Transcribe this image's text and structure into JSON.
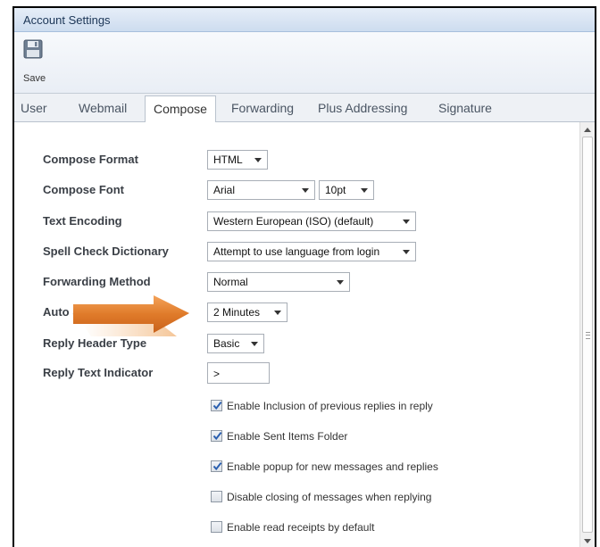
{
  "window": {
    "title": "Account Settings"
  },
  "toolbar": {
    "save_label": "Save",
    "save_icon": "floppy-disk-icon"
  },
  "tabs": [
    {
      "label": "User",
      "active": false
    },
    {
      "label": "Webmail",
      "active": false
    },
    {
      "label": "Compose",
      "active": true
    },
    {
      "label": "Forwarding",
      "active": false
    },
    {
      "label": "Plus Addressing",
      "active": false
    },
    {
      "label": "Signature",
      "active": false
    }
  ],
  "settings": {
    "compose_format": {
      "label": "Compose Format",
      "value": "HTML"
    },
    "compose_font": {
      "label": "Compose Font",
      "font": "Arial",
      "size": "10pt"
    },
    "text_encoding": {
      "label": "Text Encoding",
      "value": "Western European (ISO) (default)"
    },
    "spell_check": {
      "label": "Spell Check Dictionary",
      "value": "Attempt to use language from login"
    },
    "forwarding_method": {
      "label": "Forwarding Method",
      "value": "Normal"
    },
    "auto_save": {
      "label": "Auto Save Frequency",
      "value": "2 Minutes"
    },
    "reply_header": {
      "label": "Reply Header Type",
      "value": "Basic"
    },
    "reply_text_indicator": {
      "label": "Reply Text Indicator",
      "value": ">"
    }
  },
  "checkboxes": [
    {
      "label": "Enable Inclusion of previous replies in reply",
      "checked": true
    },
    {
      "label": "Enable Sent Items Folder",
      "checked": true
    },
    {
      "label": "Enable popup for new messages and replies",
      "checked": true
    },
    {
      "label": "Disable closing of messages when replying",
      "checked": false
    },
    {
      "label": "Enable read receipts by default",
      "checked": false
    }
  ],
  "colors": {
    "arrow": "#e07b2a",
    "check": "#2a5fb0",
    "title_bar": "#cddcef"
  }
}
